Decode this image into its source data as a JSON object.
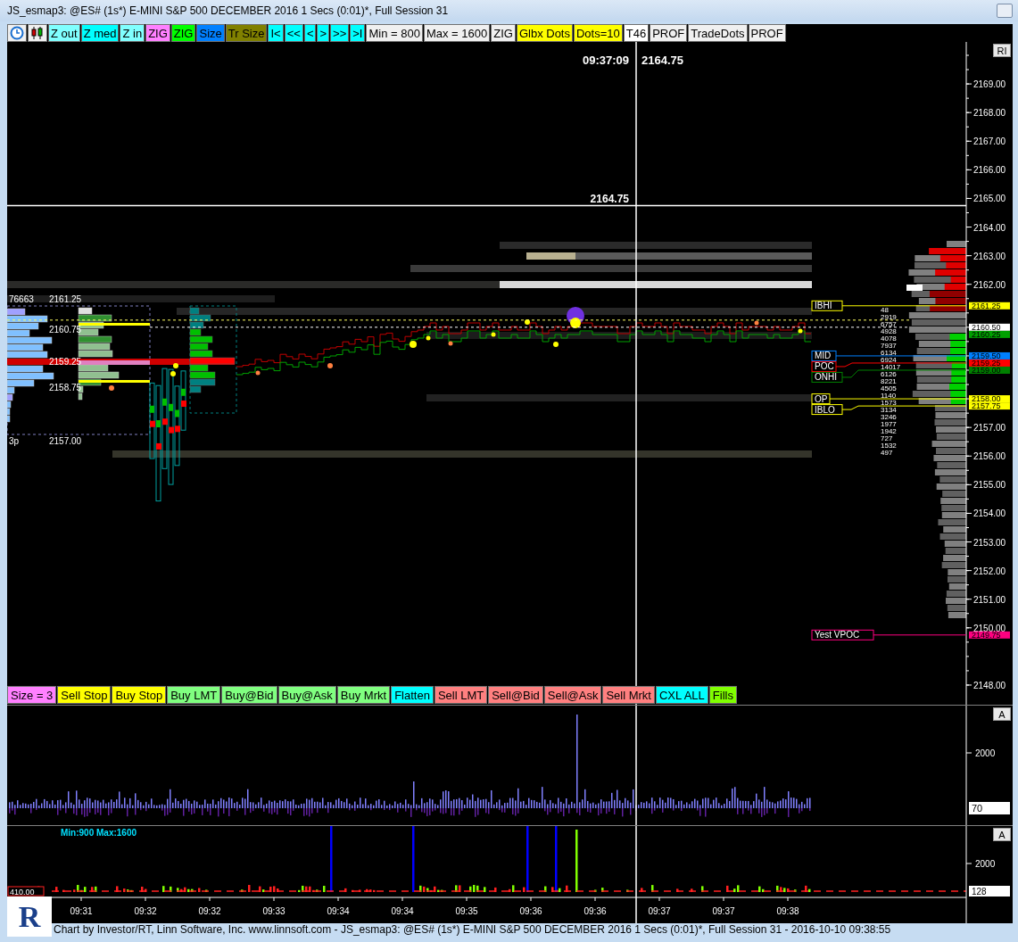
{
  "window": {
    "title": "JS_esmap3: @ES# (1s*) E-MINI S&P 500 DECEMBER 2016 1 Secs (0:01)*, Full Session 31"
  },
  "toolbar": [
    {
      "kind": "clock"
    },
    {
      "kind": "candles"
    },
    {
      "kind": "button",
      "label": "Z out",
      "color": "#80ffff"
    },
    {
      "kind": "button",
      "label": "Z med",
      "color": "#00ffff"
    },
    {
      "kind": "button",
      "label": "Z in",
      "color": "#80ffff"
    },
    {
      "kind": "button",
      "label": "ZIG",
      "color": "#ff80ff"
    },
    {
      "kind": "button",
      "label": "ZIG",
      "color": "#00ff00"
    },
    {
      "kind": "button",
      "label": "Size",
      "color": "#0080ff"
    },
    {
      "kind": "button",
      "label": "Tr Size",
      "color": "#808000"
    },
    {
      "kind": "button",
      "label": "I<",
      "color": "#00ffff"
    },
    {
      "kind": "button",
      "label": "<<",
      "color": "#00ffff"
    },
    {
      "kind": "button",
      "label": "<",
      "color": "#00ffff"
    },
    {
      "kind": "button",
      "label": ">",
      "color": "#00ffff"
    },
    {
      "kind": "button",
      "label": ">>",
      "color": "#00ffff"
    },
    {
      "kind": "button",
      "label": ">I",
      "color": "#00ffff"
    },
    {
      "kind": "button",
      "label": "Min = 800",
      "color": "#f0f0f0"
    },
    {
      "kind": "button",
      "label": "Max = 1600",
      "color": "#f0f0f0"
    },
    {
      "kind": "button",
      "label": "ZIG",
      "color": "#f0f0f0"
    },
    {
      "kind": "button",
      "label": "Glbx Dots",
      "color": "#ffff00"
    },
    {
      "kind": "button",
      "label": "Dots=10",
      "color": "#ffff00"
    },
    {
      "kind": "button",
      "label": "T46",
      "color": "#ffffff"
    },
    {
      "kind": "button",
      "label": "PROF",
      "color": "#f0f0f0"
    },
    {
      "kind": "button",
      "label": "TradeDots",
      "color": "#f0f0f0"
    },
    {
      "kind": "button",
      "label": "PROF",
      "color": "#f0f0f0"
    }
  ],
  "chart": {
    "axis_button": "RI",
    "crosshair": {
      "time": "09:37:09",
      "price": "2164.75",
      "line_label": "2164.75"
    },
    "price_axis": [
      "2169.00",
      "2168.00",
      "2167.00",
      "2166.00",
      "2165.00",
      "2164.00",
      "2163.00",
      "2162.00",
      "2157.00",
      "2156.00",
      "2155.00",
      "2154.00",
      "2153.00",
      "2152.00",
      "2151.00",
      "2150.00",
      "2148.00"
    ],
    "profile_labels": [
      "76663",
      "2161.25",
      "2160.75",
      "2159.25",
      "2158.75",
      "3p",
      "2157.00"
    ],
    "levels": [
      {
        "label": "IBHI",
        "price": "2161.25",
        "color": "#ffff00"
      },
      {
        "label": "MID",
        "price": "2159.50",
        "color": "#0080ff"
      },
      {
        "label": "POC",
        "price": "2159.25",
        "color": "#ff0000"
      },
      {
        "label": "ONHI",
        "price": "2159.00",
        "color": "#008000"
      },
      {
        "label": "OP",
        "price": "2158.00",
        "color": "#ffff00"
      },
      {
        "label": "IBLO",
        "price": "2157.75",
        "color": "#ffff00"
      },
      {
        "label": "Yest VPOC",
        "price": "2149.75",
        "color": "#ff0080"
      }
    ],
    "price_tags": [
      {
        "price": "2160.50",
        "color": "#ffffff"
      },
      {
        "price": "2160.25",
        "color": "#00a000"
      }
    ],
    "volume_column": [
      "48",
      "2919",
      "6757",
      "4928",
      "4078",
      "7937",
      "6134",
      "6924",
      "14017",
      "6126",
      "8221",
      "4505",
      "1140",
      "1573",
      "3134",
      "3246",
      "1977",
      "1942",
      "727",
      "1532",
      "497"
    ]
  },
  "order_buttons": [
    {
      "label": "Size = 3",
      "color": "#ff80ff"
    },
    {
      "label": "Sell Stop",
      "color": "#ffff00"
    },
    {
      "label": "Buy Stop",
      "color": "#ffff00"
    },
    {
      "label": "Buy LMT",
      "color": "#80ff80"
    },
    {
      "label": "Buy@Bid",
      "color": "#80ff80"
    },
    {
      "label": "Buy@Ask",
      "color": "#80ff80"
    },
    {
      "label": "Buy Mrkt",
      "color": "#80ff80"
    },
    {
      "label": "Flatten",
      "color": "#00ffff"
    },
    {
      "label": "Sell LMT",
      "color": "#ff8080"
    },
    {
      "label": "Sell@Bid",
      "color": "#ff8080"
    },
    {
      "label": "Sell@Ask",
      "color": "#ff8080"
    },
    {
      "label": "Sell Mrkt",
      "color": "#ff8080"
    },
    {
      "label": "CXL ALL",
      "color": "#00ffff"
    },
    {
      "label": "Fills",
      "color": "#80ff00"
    }
  ],
  "volume_panel": {
    "button": "A",
    "axis": [
      "2000"
    ],
    "value_tag": "70"
  },
  "indicator_panel": {
    "button": "A",
    "caption": "Min:900 Max:1600",
    "axis": [
      "2000"
    ],
    "value_tag": "128",
    "marker": "410.00"
  },
  "time_axis": [
    "09:31",
    "09:32",
    "09:32",
    "09:33",
    "09:34",
    "09:34",
    "09:35",
    "09:36",
    "09:36",
    "09:37",
    "09:37",
    "09:38"
  ],
  "logo": {
    "letter": "R"
  },
  "status_bar": "Chart by Investor/RT, Linn Software, Inc. www.linnsoft.com - JS_esmap3: @ES# (1s*) E-MINI S&P 500 DECEMBER 2016 1 Secs (0:01)*, Full Session 31 - 2016-10-10 09:38:55"
}
